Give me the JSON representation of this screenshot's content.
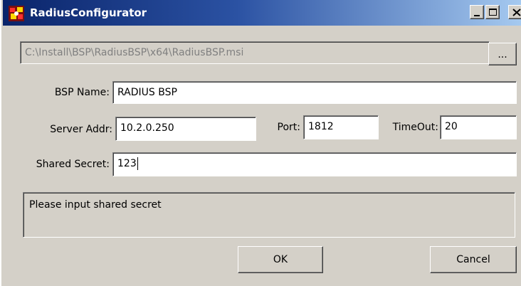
{
  "window": {
    "title": "RadiusConfigurator",
    "icon": "radius-app-icon",
    "caption_buttons": [
      "minimize-icon",
      "maximize-icon",
      "close-icon"
    ]
  },
  "installer": {
    "path": "C:\\Install\\BSP\\RadiusBSP\\x64\\RadiusBSP.msi",
    "browse_label": "..."
  },
  "bsp_name": {
    "label": "BSP Name:",
    "value": "RADIUS BSP"
  },
  "server_addr": {
    "label": "Server Addr:",
    "value": "10.2.0.250"
  },
  "port": {
    "label": "Port:",
    "value": "1812"
  },
  "timeout": {
    "label": "TimeOut:",
    "value": "20"
  },
  "shared_secret": {
    "label": "Shared Secret:",
    "value": "123"
  },
  "status": {
    "message": "Please input shared secret"
  },
  "buttons": {
    "ok": "OK",
    "cancel": "Cancel"
  }
}
